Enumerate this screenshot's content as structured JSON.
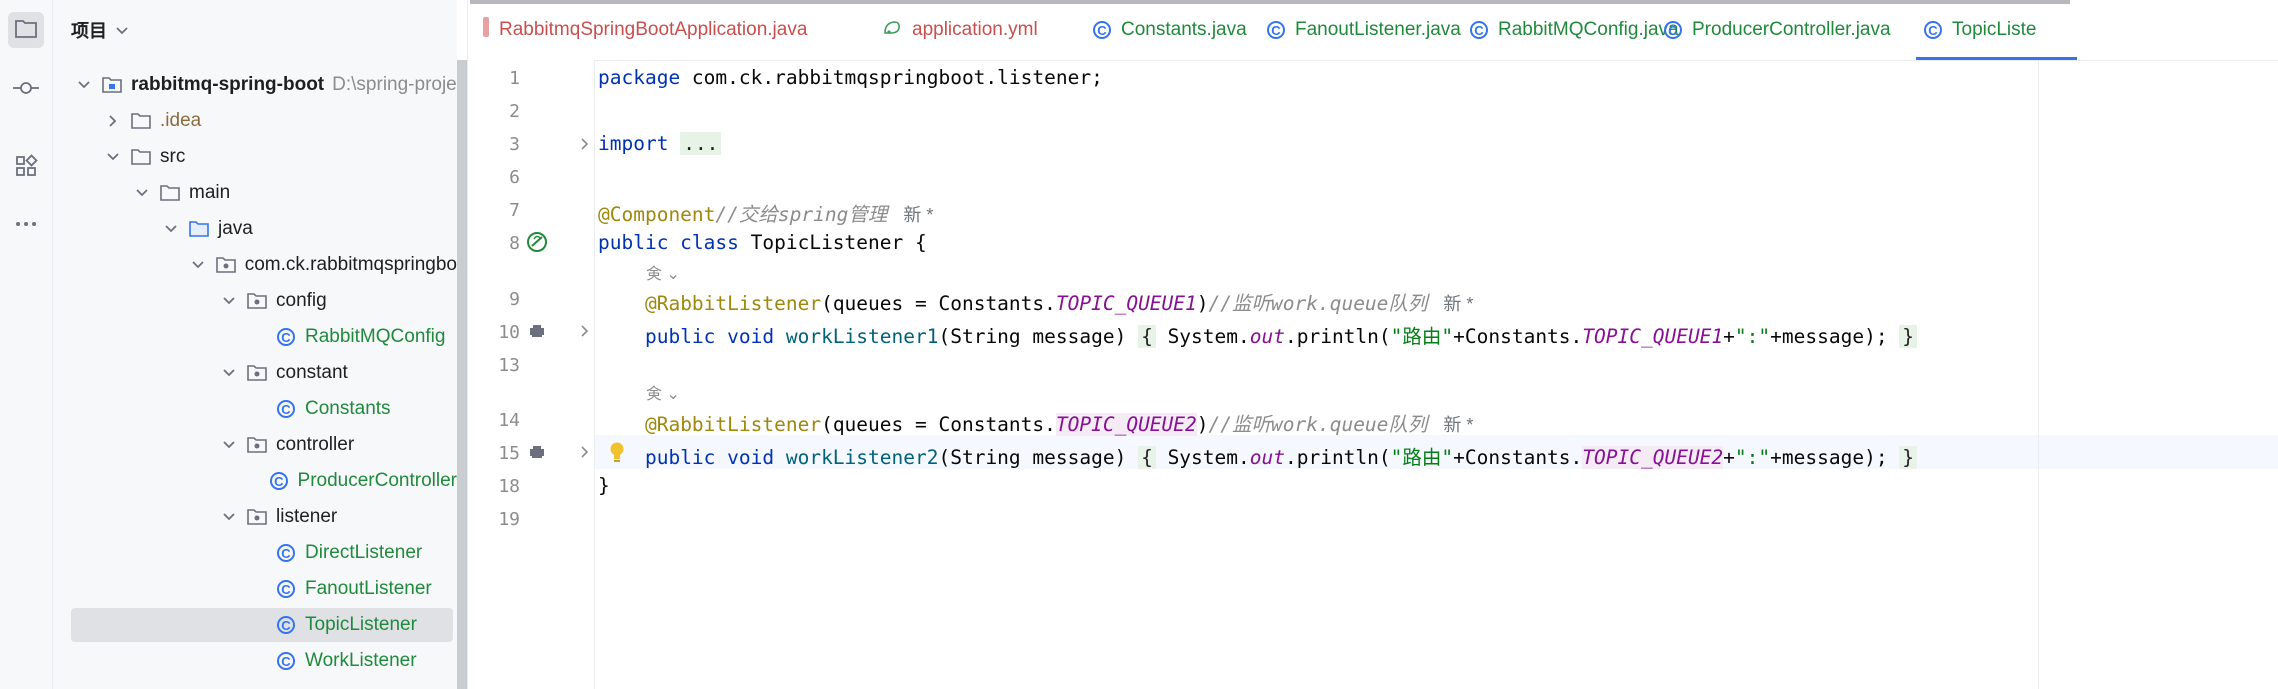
{
  "sidebar": {
    "icons": [
      "folder-icon",
      "commit-icon",
      "structure-icon",
      "more-icon"
    ]
  },
  "project": {
    "title": "项目",
    "tree": [
      {
        "label": "rabbitmq-spring-boot",
        "path": "D:\\spring-proje",
        "depth": 0,
        "type": "module",
        "expanded": true
      },
      {
        "label": ".idea",
        "depth": 1,
        "type": "folder",
        "expanded": false
      },
      {
        "label": "src",
        "depth": 1,
        "type": "folder",
        "expanded": true
      },
      {
        "label": "main",
        "depth": 2,
        "type": "folder",
        "expanded": true
      },
      {
        "label": "java",
        "depth": 3,
        "type": "src-folder",
        "expanded": true
      },
      {
        "label": "com.ck.rabbitmqspringbo",
        "depth": 4,
        "type": "package",
        "expanded": true
      },
      {
        "label": "config",
        "depth": 5,
        "type": "package",
        "expanded": true
      },
      {
        "label": "RabbitMQConfig",
        "depth": 6,
        "type": "class"
      },
      {
        "label": "constant",
        "depth": 5,
        "type": "package",
        "expanded": true
      },
      {
        "label": "Constants",
        "depth": 6,
        "type": "class"
      },
      {
        "label": "controller",
        "depth": 5,
        "type": "package",
        "expanded": true
      },
      {
        "label": "ProducerController",
        "depth": 6,
        "type": "class"
      },
      {
        "label": "listener",
        "depth": 5,
        "type": "package",
        "expanded": true
      },
      {
        "label": "DirectListener",
        "depth": 6,
        "type": "class"
      },
      {
        "label": "FanoutListener",
        "depth": 6,
        "type": "class"
      },
      {
        "label": "TopicListener",
        "depth": 6,
        "type": "class",
        "selected": true
      },
      {
        "label": "WorkListener",
        "depth": 6,
        "type": "class"
      }
    ]
  },
  "tabs": [
    {
      "label": "RabbitmqSpringBootApplication.java",
      "color": "red",
      "icon": "java-class-icon"
    },
    {
      "label": "application.yml",
      "color": "red",
      "icon": "yaml-icon"
    },
    {
      "label": "Constants.java",
      "color": "green",
      "icon": "class-icon"
    },
    {
      "label": "FanoutListener.java",
      "color": "green",
      "icon": "class-icon"
    },
    {
      "label": "RabbitMQConfig.java",
      "color": "green",
      "icon": "class-icon"
    },
    {
      "label": "ProducerController.java",
      "color": "green",
      "icon": "class-icon"
    },
    {
      "label": "TopicListe",
      "color": "green",
      "icon": "class-icon",
      "active": true
    }
  ],
  "editor": {
    "line_numbers": [
      "1",
      "2",
      "3",
      "6",
      "7",
      "8",
      "9",
      "10",
      "13",
      "14",
      "15",
      "18",
      "19"
    ],
    "lines": {
      "l1_kw": "package",
      "l1_rest": " com.ck.rabbitmqspringboot.listener;",
      "l3_kw": "import",
      "l3_fold": "...",
      "l7_anno": "@Component",
      "l7_cmt": "//交给spring管理",
      "l7_hint": "新 *",
      "l8_kw": "public class",
      "l8_rest": " TopicListener {",
      "ghost_1": "㑒 ⌄",
      "l9_anno": "@RabbitListener",
      "l9_a": "(queues = Constants.",
      "l9_fld": "TOPIC_QUEUE1",
      "l9_b": ")",
      "l9_cmt": "//监听work.queue队列",
      "l9_hint": "新 *",
      "l10_kw": "public void",
      "l10_fn": " workListener1",
      "l10_a": "(String message) ",
      "l10_open": "{",
      "l10_b": " System.",
      "l10_out": "out",
      "l10_c": ".println(",
      "l10_str1": "\"路由\"",
      "l10_d": "+Constants.",
      "l10_fld": "TOPIC_QUEUE1",
      "l10_e": "+",
      "l10_str2": "\":\"",
      "l10_f": "+message); ",
      "l10_close": "}",
      "ghost_2": "㑒 ⌄",
      "l14_anno": "@RabbitListener",
      "l14_a": "(queues = Constants.",
      "l14_fld": "TOPIC_QUEUE2",
      "l14_b": ")",
      "l14_cmt": "//监听work.queue队列",
      "l14_hint": "新 *",
      "l15_kw": "public void",
      "l15_fn": " workListener2",
      "l15_a": "(String message) ",
      "l15_open": "{",
      "l15_b": " System.",
      "l15_out": "out",
      "l15_c": ".println(",
      "l15_str1": "\"路由\"",
      "l15_d": "+Constants.",
      "l15_fld": "TOPIC_QUEUE2",
      "l15_e": "+",
      "l15_str2": "\":\"",
      "l15_f": "+message); ",
      "l15_close": "}",
      "l18": "}"
    }
  }
}
